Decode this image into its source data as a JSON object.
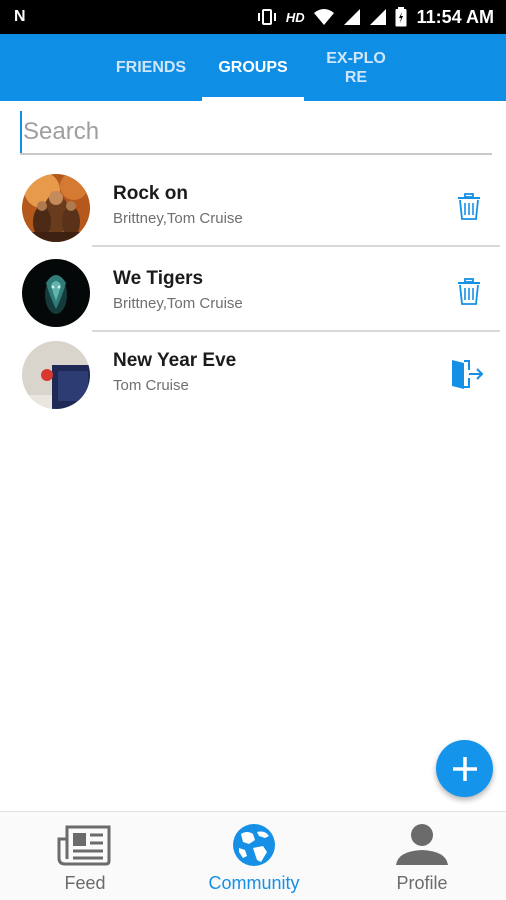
{
  "status_bar": {
    "notification_icon": "N",
    "hd": "HD",
    "time": "11:54 AM",
    "icons": [
      "vibrate-icon",
      "wifi-icon",
      "signal-icon",
      "battery-icon"
    ]
  },
  "tabs": [
    {
      "label": "FRIENDS",
      "active": false
    },
    {
      "label": "GROUPS",
      "active": true
    },
    {
      "label": "EX-PLORE",
      "active": false
    }
  ],
  "search": {
    "placeholder": "Search",
    "value": ""
  },
  "groups": [
    {
      "name": "Rock on",
      "members": "Brittney,Tom Cruise",
      "action": "delete"
    },
    {
      "name": "We Tigers",
      "members": "Brittney,Tom Cruise",
      "action": "delete"
    },
    {
      "name": "New Year Eve",
      "members": "Tom Cruise",
      "action": "leave"
    }
  ],
  "bottom_nav": [
    {
      "label": "Feed",
      "icon": "newspaper-icon",
      "active": false
    },
    {
      "label": "Community",
      "icon": "globe-icon",
      "active": true
    },
    {
      "label": "Profile",
      "icon": "person-icon",
      "active": false
    }
  ],
  "colors": {
    "primary": "#0f8ee6",
    "active_tab": "#ffffff",
    "inactive_tab": "#cfe6fb",
    "icon_blue": "#1590e6",
    "nav_gray": "#6b6b6b"
  }
}
